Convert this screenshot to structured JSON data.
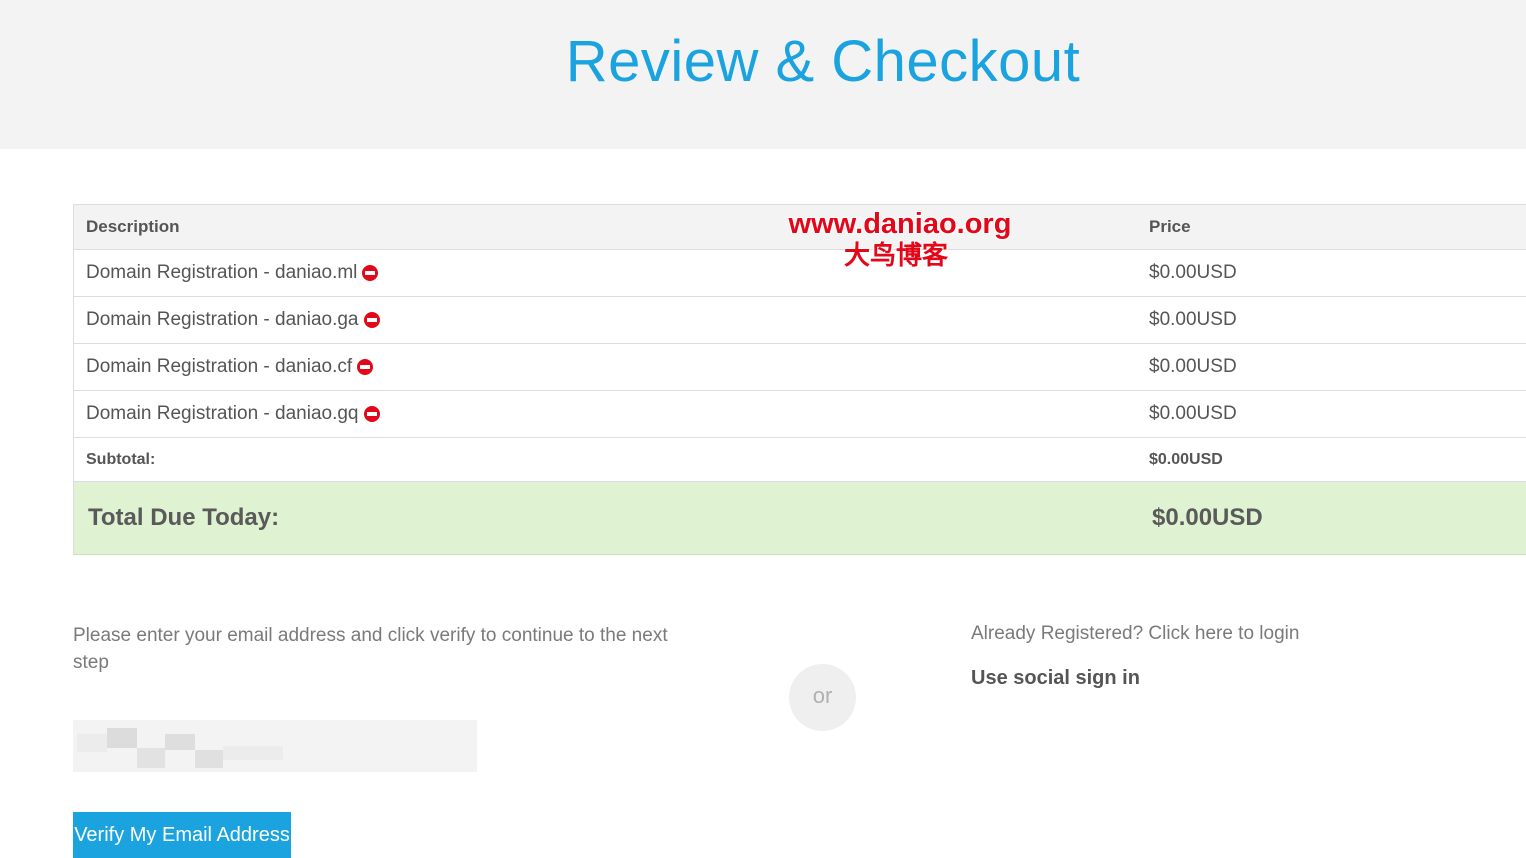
{
  "header": {
    "title": "Review & Checkout"
  },
  "table": {
    "headers": {
      "description": "Description",
      "price": "Price"
    },
    "items": [
      {
        "description": "Domain Registration - daniao.ml",
        "price": "$0.00USD"
      },
      {
        "description": "Domain Registration - daniao.ga",
        "price": "$0.00USD"
      },
      {
        "description": "Domain Registration - daniao.cf",
        "price": "$0.00USD"
      },
      {
        "description": "Domain Registration - daniao.gq",
        "price": "$0.00USD"
      }
    ],
    "subtotal": {
      "label": "Subtotal:",
      "value": "$0.00USD"
    },
    "total": {
      "label": "Total Due Today:",
      "value": "$0.00USD"
    }
  },
  "watermark": {
    "url": "www.daniao.org",
    "name": "大鸟博客"
  },
  "email_section": {
    "prompt": "Please enter your email address and click verify to continue to the next step",
    "button_label": "Verify My Email Address"
  },
  "divider": {
    "or_label": "or"
  },
  "login_section": {
    "link_text": "Already Registered? Click here to login",
    "social_label": "Use social sign in"
  },
  "colors": {
    "accent": "#1aa3df",
    "total_row_bg": "#dff2d1",
    "remove_icon": "#e3071a",
    "header_bg": "#f3f3f3"
  },
  "icons": {
    "remove": "remove-circle-icon"
  }
}
